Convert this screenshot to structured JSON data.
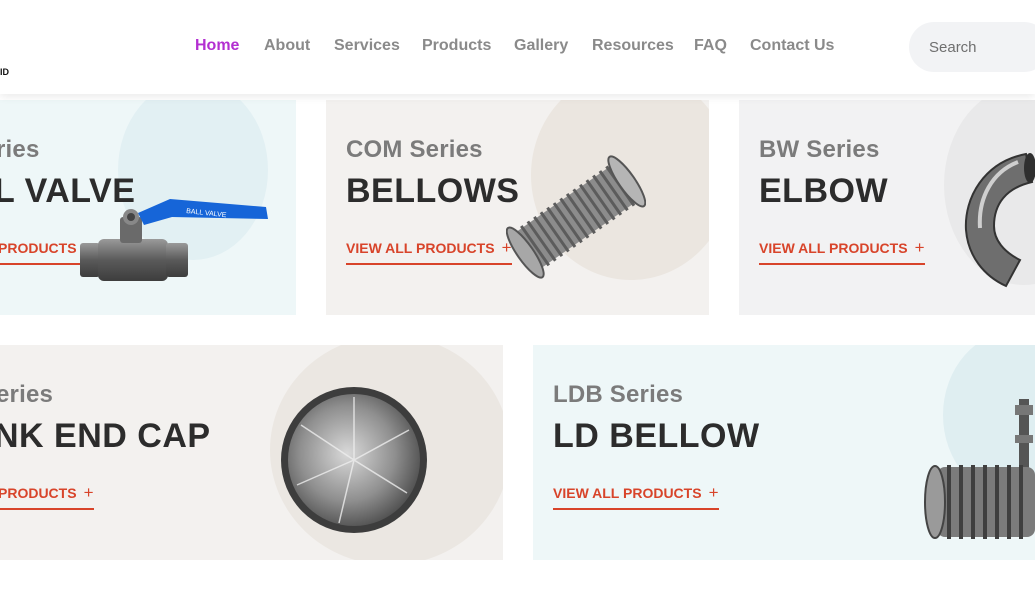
{
  "header": {
    "logo_fragment": "ID",
    "nav": [
      {
        "label": "Home",
        "active": true
      },
      {
        "label": "About",
        "active": false
      },
      {
        "label": "Services",
        "active": false
      },
      {
        "label": "Products",
        "active": false
      },
      {
        "label": "Gallery",
        "active": false
      },
      {
        "label": "Resources",
        "active": false
      },
      {
        "label": "FAQ",
        "active": false
      },
      {
        "label": "Contact Us",
        "active": false
      }
    ],
    "search_placeholder": "Search"
  },
  "cards": [
    {
      "series": "ries",
      "name": "L VALVE",
      "link": "PRODUCTS",
      "link_icon": "+",
      "product_icon": "ball-valve-icon",
      "valve_text": "BALL VALVE"
    },
    {
      "series": "COM Series",
      "name": "BELLOWS",
      "link": "VIEW ALL PRODUCTS",
      "link_icon": "+",
      "product_icon": "bellows-icon"
    },
    {
      "series": "BW Series",
      "name": "ELBOW",
      "link": "VIEW ALL PRODUCTS",
      "link_icon": "+",
      "product_icon": "elbow-icon"
    },
    {
      "series": "eries",
      "name": "NK END CAP",
      "link": "PRODUCTS",
      "link_icon": "+",
      "product_icon": "end-cap-icon"
    },
    {
      "series": "LDB Series",
      "name": "LD BELLOW",
      "link": "VIEW ALL PRODUCTS",
      "link_icon": "+",
      "product_icon": "ld-bellow-icon"
    }
  ],
  "colors": {
    "accent": "#d8442a",
    "nav_active": "#b32fd1",
    "mint_bg": "#eef7f8",
    "warm_bg": "#f3f1ef"
  }
}
